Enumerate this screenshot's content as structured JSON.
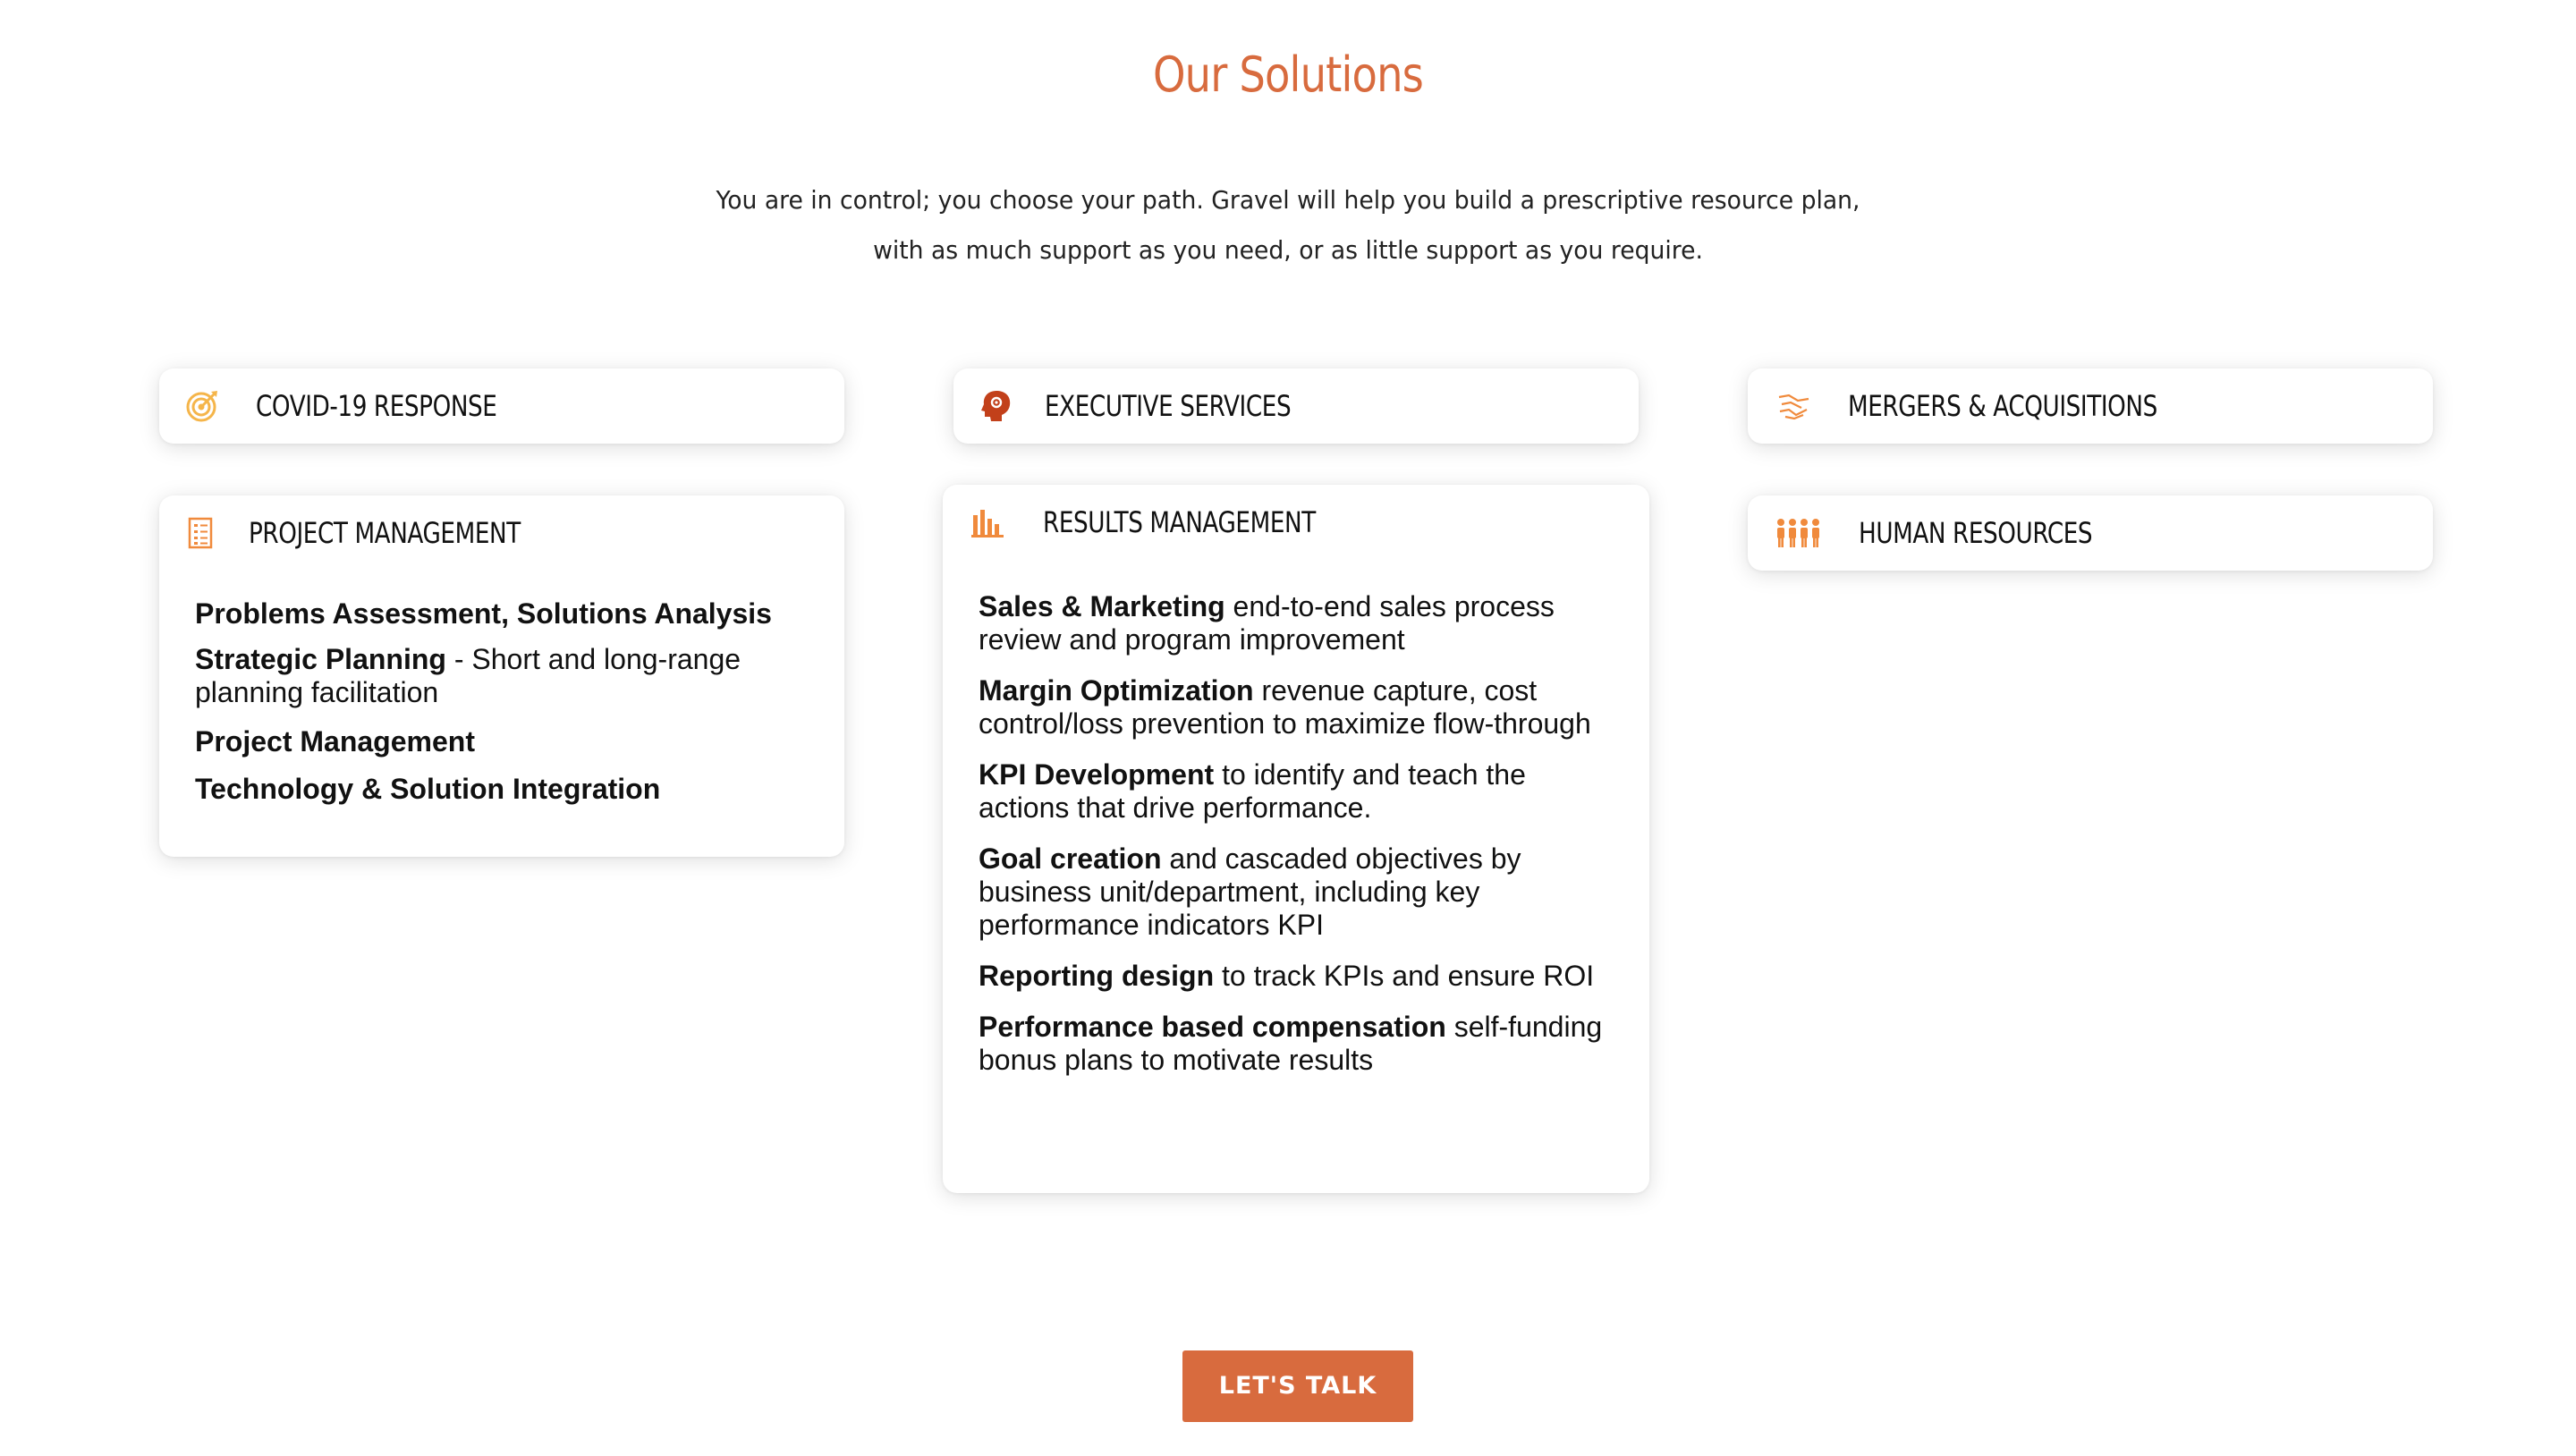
{
  "title": "Our Solutions",
  "intro": {
    "line1": "You are in control; you choose your path. Gravel will help you build a prescriptive resource plan,",
    "line2": "with as much support as you need, or as little support as you require."
  },
  "cards": {
    "covid": {
      "label": "COVID-19 RESPONSE",
      "icon": "target-icon"
    },
    "executive": {
      "label": "EXECUTIVE SERVICES",
      "icon": "brain-gear-icon"
    },
    "mergers": {
      "label": "MERGERS & ACQUISITIONS",
      "icon": "handshake-icon"
    },
    "project": {
      "label": "PROJECT MANAGEMENT",
      "icon": "checklist-icon",
      "items": [
        {
          "bold": "Problems Assessment, Solutions Analysis",
          "text": ""
        },
        {
          "bold": "Strategic Planning",
          "text": " - Short and long-range planning facilitation"
        },
        {
          "bold": "Project Management",
          "text": ""
        },
        {
          "bold": "Technology & Solution Integration",
          "text": ""
        }
      ]
    },
    "results": {
      "label": "RESULTS MANAGEMENT",
      "icon": "bar-chart-icon",
      "items": [
        {
          "bold": "Sales & Marketing",
          "text": " end-to-end sales process review and program improvement"
        },
        {
          "bold": "Margin Optimization",
          "text": " revenue capture, cost control/loss prevention to maximize flow-through"
        },
        {
          "bold": "KPI Development",
          "text": " to identify and teach the actions that drive performance."
        },
        {
          "bold": "Goal creation",
          "text": " and cascaded objectives by business unit/department, including key performance indicators KPI"
        },
        {
          "bold": "Reporting design",
          "text": " to track KPIs and ensure ROI"
        },
        {
          "bold": "Performance based compensation",
          "text": " self-funding bonus plans to motivate results"
        }
      ]
    },
    "hr": {
      "label": "HUMAN RESOURCES",
      "icon": "people-group-icon"
    }
  },
  "cta": {
    "label": "LET'S TALK"
  },
  "colors": {
    "accent": "#d86b3e",
    "icon_orange": "#f08a3c",
    "icon_yellow": "#f5b54a",
    "icon_red": "#c2401a"
  }
}
